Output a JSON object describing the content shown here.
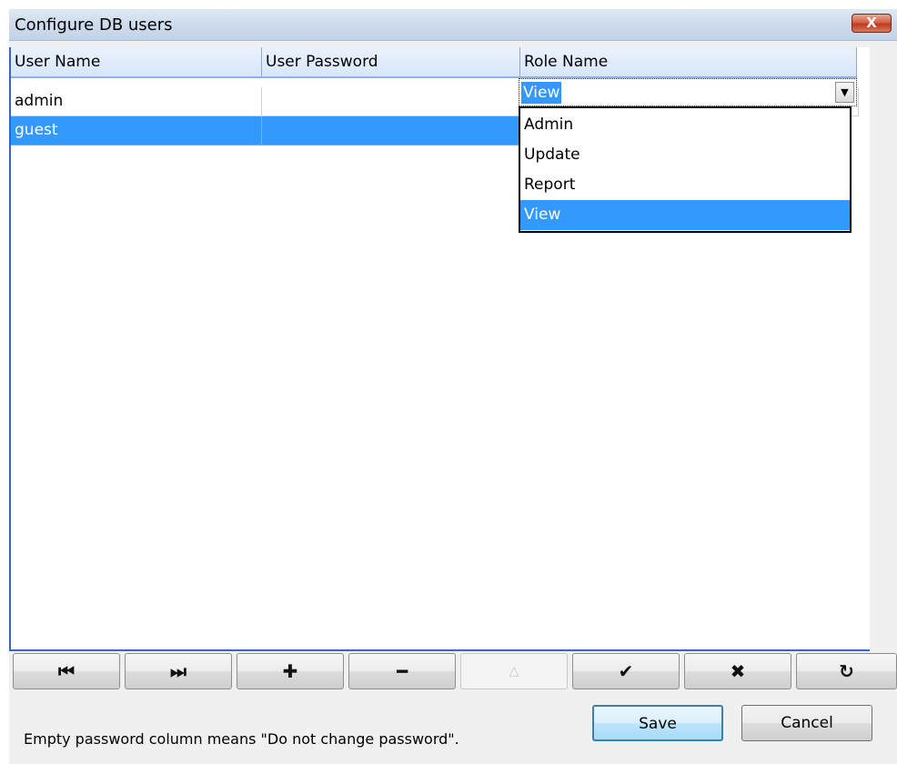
{
  "window": {
    "title": "Configure DB users",
    "close_label": "X"
  },
  "grid": {
    "columns": [
      "User Name",
      "User Password",
      "Role Name"
    ],
    "rows": [
      {
        "user": "admin",
        "password": "",
        "role": "Admin"
      },
      {
        "user": "guest",
        "password": "",
        "role": "View"
      }
    ],
    "selected_row": "guest"
  },
  "role_editor": {
    "value": "View",
    "options": [
      "Admin",
      "Update",
      "Report",
      "View"
    ],
    "highlighted": "View"
  },
  "navigator": {
    "first": "⏮",
    "last": "⏭",
    "insert": "✚",
    "delete": "━",
    "edit": "△",
    "post": "✔",
    "cancel": "✖",
    "refresh": "↻"
  },
  "footer": {
    "hint": "Empty password column means \"Do not change password\".",
    "save_label": "Save",
    "cancel_label": "Cancel"
  },
  "colors": {
    "selection": "#3399ff",
    "grid_border": "#3b64c8",
    "title_bg": "#cfdcec"
  }
}
